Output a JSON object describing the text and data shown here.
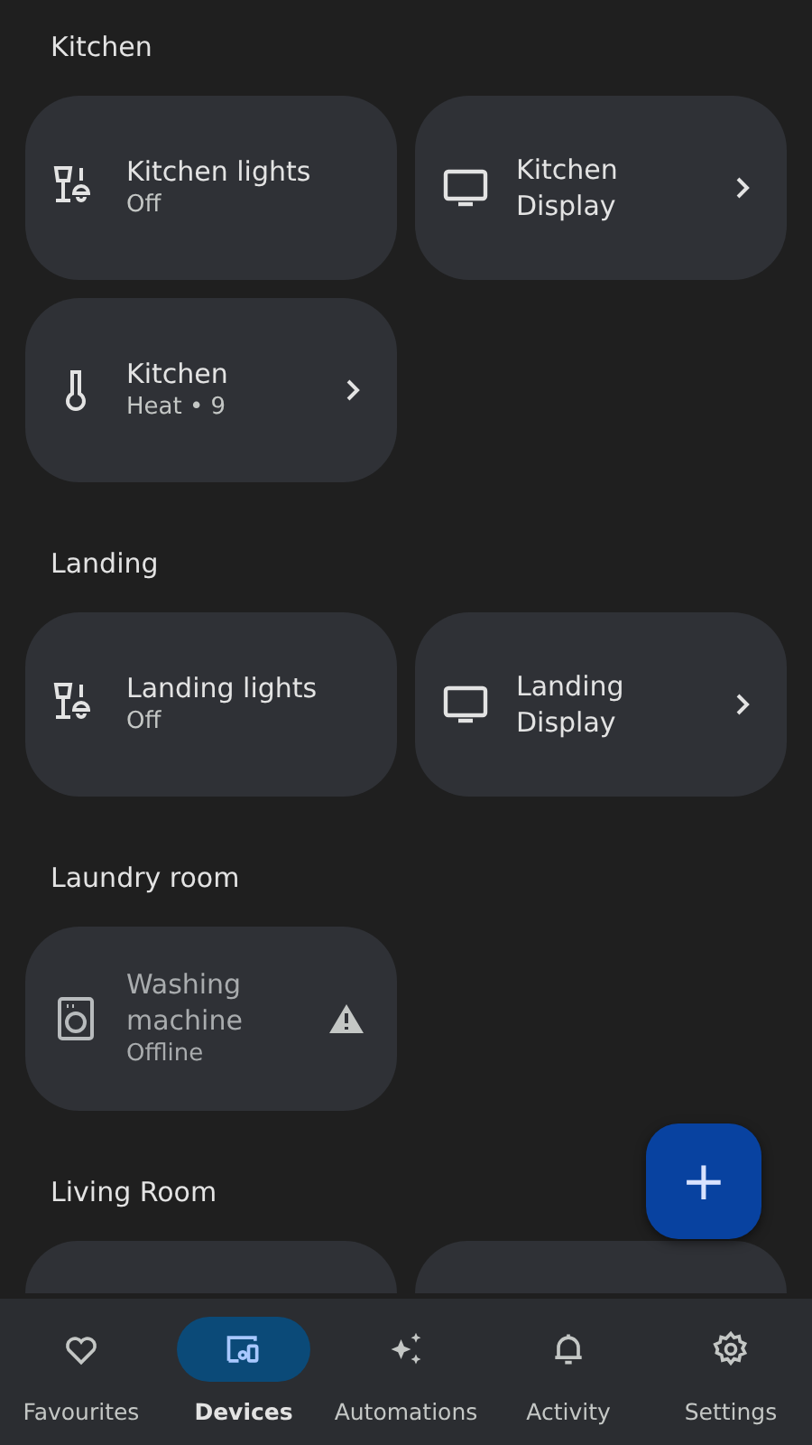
{
  "rooms": [
    {
      "name": "Kitchen",
      "devices": [
        {
          "kind": "light",
          "name": "Kitchen lights",
          "status": "Off",
          "offline": false,
          "chevron": false,
          "warning": false
        },
        {
          "kind": "display",
          "name": "Kitchen Display",
          "offline": false,
          "chevron": true,
          "warning": false
        },
        {
          "kind": "thermostat",
          "name": "Kitchen",
          "status": "Heat • 9",
          "offline": false,
          "chevron": true,
          "warning": false
        }
      ]
    },
    {
      "name": "Landing",
      "devices": [
        {
          "kind": "light",
          "name": "Landing lights",
          "status": "Off",
          "offline": false,
          "chevron": false,
          "warning": false
        },
        {
          "kind": "display",
          "name": "Landing Display",
          "offline": false,
          "chevron": true,
          "warning": false
        }
      ]
    },
    {
      "name": "Laundry room",
      "devices": [
        {
          "kind": "washer",
          "name": "Washing machine",
          "status": "Offline",
          "offline": true,
          "chevron": false,
          "warning": true
        }
      ]
    },
    {
      "name": "Living Room",
      "devices": [
        {
          "kind": "hidden"
        },
        {
          "kind": "hidden"
        }
      ]
    }
  ],
  "fab": {
    "label": "+"
  },
  "nav": [
    {
      "kind": "heart",
      "label": "Favourites",
      "selected": false
    },
    {
      "kind": "devices",
      "label": "Devices",
      "selected": true
    },
    {
      "kind": "sparkle",
      "label": "Automations",
      "selected": false
    },
    {
      "kind": "bell",
      "label": "Activity",
      "selected": false
    },
    {
      "kind": "gear",
      "label": "Settings",
      "selected": false
    }
  ]
}
